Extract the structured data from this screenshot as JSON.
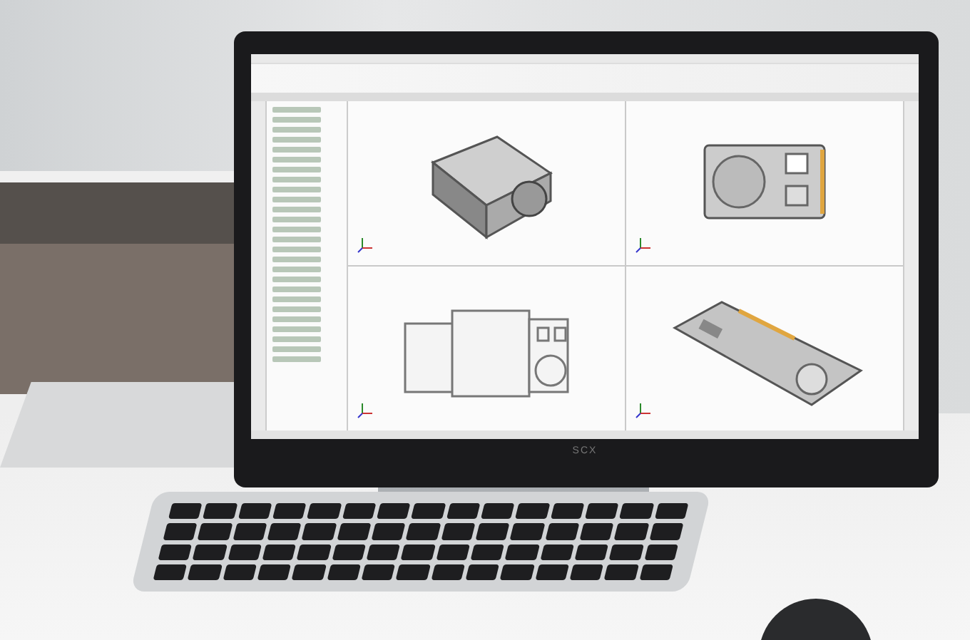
{
  "monitor": {
    "brand": "SCX"
  },
  "cad_window": {
    "viewports": [
      {
        "kind": "iso"
      },
      {
        "kind": "top"
      },
      {
        "kind": "front"
      },
      {
        "kind": "angled"
      }
    ]
  }
}
